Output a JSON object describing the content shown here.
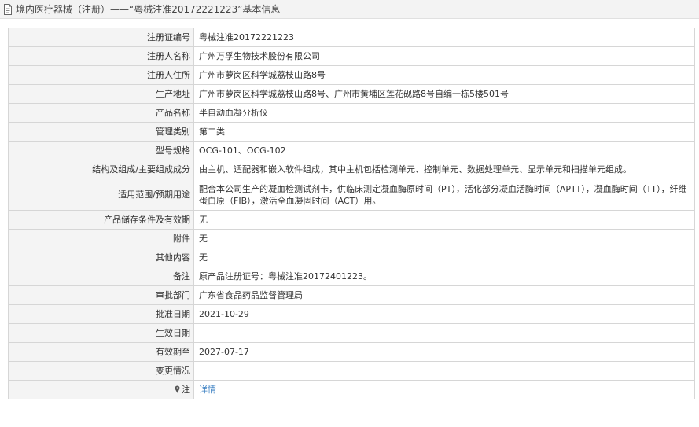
{
  "header": {
    "title": "境内医疗器械（注册）——“粤械注准20172221223”基本信息",
    "icon": "document-icon"
  },
  "rows": [
    {
      "key": "registration_no",
      "label": "注册证编号",
      "value": "粤械注准20172221223"
    },
    {
      "key": "registrant_name",
      "label": "注册人名称",
      "value": "广州万孚生物技术股份有限公司"
    },
    {
      "key": "registrant_address",
      "label": "注册人住所",
      "value": "广州市萝岗区科学城荔枝山路8号"
    },
    {
      "key": "production_address",
      "label": "生产地址",
      "value": "广州市萝岗区科学城荔枝山路8号、广州市黄埔区莲花砚路8号自编一栋5楼501号"
    },
    {
      "key": "product_name",
      "label": "产品名称",
      "value": "半自动血凝分析仪"
    },
    {
      "key": "management_class",
      "label": "管理类别",
      "value": "第二类"
    },
    {
      "key": "model_spec",
      "label": "型号规格",
      "value": "OCG-101、OCG-102"
    },
    {
      "key": "structure",
      "label": "结构及组成/主要组成成分",
      "value": "由主机、适配器和嵌入软件组成，其中主机包括检测单元、控制单元、数据处理单元、显示单元和扫描单元组成。"
    },
    {
      "key": "scope",
      "label": "适用范围/预期用途",
      "value": "配合本公司生产的凝血检测试剂卡，供临床测定凝血酶原时间（PT），活化部分凝血活酶时间（APTT），凝血酶时间（TT），纤维蛋白原（FIB），激活全血凝固时间（ACT）用。"
    },
    {
      "key": "storage",
      "label": "产品储存条件及有效期",
      "value": "无"
    },
    {
      "key": "accessories",
      "label": "附件",
      "value": "无"
    },
    {
      "key": "other",
      "label": "其他内容",
      "value": "无"
    },
    {
      "key": "remarks",
      "label": "备注",
      "value": "原产品注册证号：粤械注准20172401223。"
    },
    {
      "key": "approval_dept",
      "label": "审批部门",
      "value": "广东省食品药品监督管理局"
    },
    {
      "key": "approval_date",
      "label": "批准日期",
      "value": "2021-10-29"
    },
    {
      "key": "effective_date",
      "label": "生效日期",
      "value": ""
    },
    {
      "key": "expiry_date",
      "label": "有效期至",
      "value": "2027-07-17"
    },
    {
      "key": "change_status",
      "label": "变更情况",
      "value": ""
    }
  ],
  "note_row": {
    "label": "注",
    "icon": "pin-icon",
    "link_text": "详情",
    "link_color": "#3a7fc2"
  }
}
